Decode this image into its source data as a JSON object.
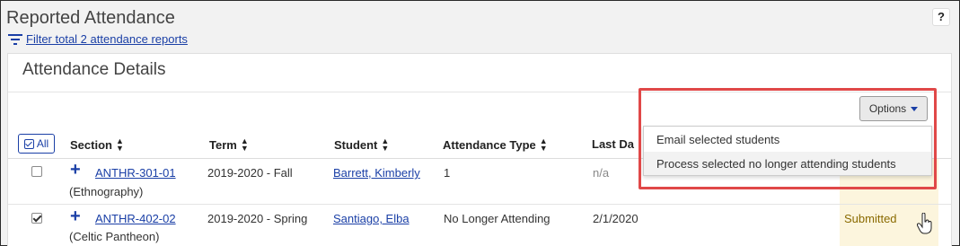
{
  "header": {
    "title": "Reported Attendance",
    "help_label": "?",
    "filter_link": "Filter total 2 attendance reports"
  },
  "panel": {
    "title": "Attendance Details",
    "select_all_label": "All"
  },
  "options": {
    "button_label": "Options",
    "items": [
      "Email selected students",
      "Process selected no longer attending students"
    ]
  },
  "columns": [
    "Section",
    "Term",
    "Student",
    "Attendance Type",
    "Last Da"
  ],
  "rows": [
    {
      "checked": false,
      "section": "ANTHR-301-01",
      "section_name": "(Ethnography)",
      "term": "2019-2020 - Fall",
      "student": "Barrett, Kimberly",
      "attendance_type": "1",
      "last_date": "n/a",
      "status": ""
    },
    {
      "checked": true,
      "section": "ANTHR-402-02",
      "section_name": "(Celtic Pantheon)",
      "term": "2019-2020 - Spring",
      "student": "Santiago, Elba",
      "attendance_type": "No Longer Attending",
      "last_date": "2/1/2020",
      "status": "Submitted"
    }
  ],
  "colors": {
    "link": "#1a3fa6",
    "highlight_border": "#e04848",
    "status_bg": "#fcf5dd",
    "status_text": "#8a6a00"
  },
  "icons": [
    "filter-icon",
    "help-icon",
    "checkbox-icon",
    "sort-icon",
    "plus-icon",
    "caret-down-icon",
    "hand-cursor-icon"
  ]
}
